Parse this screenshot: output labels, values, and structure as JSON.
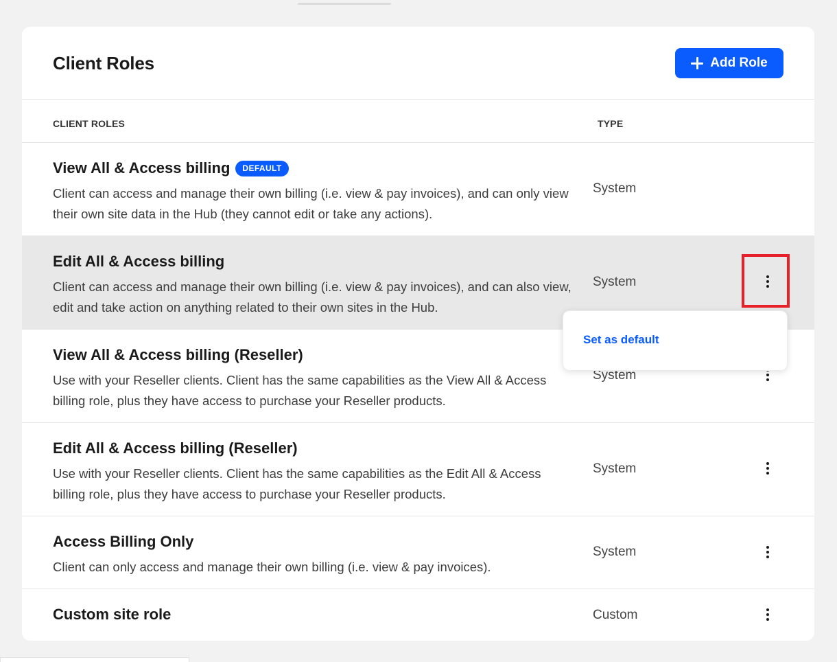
{
  "header": {
    "title": "Client Roles",
    "add_button_label": "Add Role"
  },
  "table": {
    "columns": {
      "role": "CLIENT ROLES",
      "type": "TYPE"
    },
    "rows": [
      {
        "title": "View All & Access billing",
        "badge": "DEFAULT",
        "description": "Client can access and manage their own billing (i.e. view & pay invoices), and can only view their own site data in the Hub (they cannot edit or take any actions).",
        "type": "System"
      },
      {
        "title": "Edit All & Access billing",
        "description": "Client can access and manage their own billing (i.e. view & pay invoices), and can also view, edit and take action on anything related to their own sites in the Hub.",
        "type": "System"
      },
      {
        "title": "View All & Access billing (Reseller)",
        "description": "Use with your Reseller clients. Client has the same capabilities as the View All & Access billing role, plus they have access to purchase your Reseller products.",
        "type": "System"
      },
      {
        "title": "Edit All & Access billing (Reseller)",
        "description": "Use with your Reseller clients. Client has the same capabilities as the Edit All & Access billing role, plus they have access to purchase your Reseller products.",
        "type": "System"
      },
      {
        "title": "Access Billing Only",
        "description": "Client can only access and manage their own billing (i.e. view & pay invoices).",
        "type": "System"
      },
      {
        "title": "Custom site role",
        "type": "Custom"
      }
    ]
  },
  "dropdown": {
    "items": [
      "Set as default"
    ]
  },
  "colors": {
    "accent": "#0a5cff",
    "highlight_border": "#e8202a",
    "row_hover": "#e8e8e8"
  }
}
